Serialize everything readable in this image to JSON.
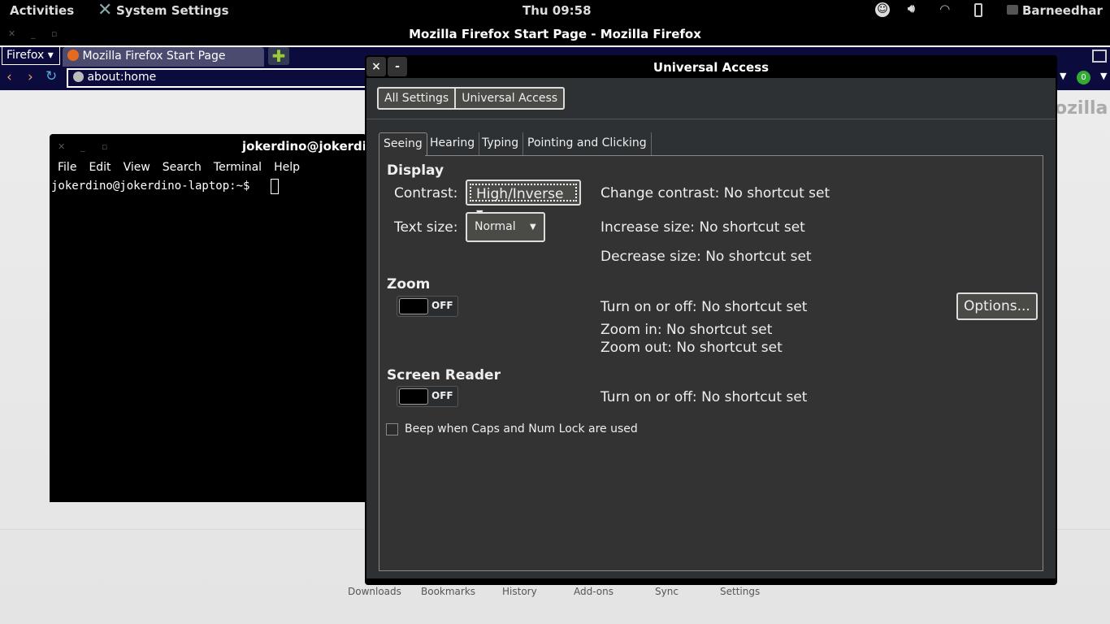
{
  "topbar": {
    "activities": "Activities",
    "app_name": "System Settings",
    "clock": "Thu 09:58",
    "user": "Barneedhar",
    "icons": [
      "accessibility-icon",
      "volume-icon",
      "wifi-icon",
      "battery-icon",
      "chat-icon"
    ]
  },
  "firefox": {
    "window_title": "Mozilla Firefox Start Page - Mozilla Firefox",
    "menu_button": "Firefox",
    "tab_title": "Mozilla Firefox Start Page",
    "url": "about:home",
    "logo_text": "ozilla",
    "badge_count": "0",
    "bottom_items": [
      "Downloads",
      "Bookmarks",
      "History",
      "Add-ons",
      "Sync",
      "Settings"
    ]
  },
  "terminal": {
    "title": "jokerdino@jokerdi",
    "menu": [
      "File",
      "Edit",
      "View",
      "Search",
      "Terminal",
      "Help"
    ],
    "prompt": "jokerdino@jokerdino-laptop:~$"
  },
  "dialog": {
    "title": "Universal Access",
    "close": "×",
    "minimize": "-",
    "breadcrumb": [
      "All Settings",
      "Universal Access"
    ],
    "tabs": [
      "Seeing",
      "Hearing",
      "Typing",
      "Pointing and Clicking"
    ],
    "active_tab": "Seeing",
    "display": {
      "header": "Display",
      "contrast_label": "Contrast:",
      "contrast_value": "High/Inverse",
      "text_size_label": "Text size:",
      "text_size_value": "Normal",
      "shortcuts": [
        {
          "label": "Change contrast:",
          "value": "No shortcut set"
        },
        {
          "label": "Increase size:",
          "value": "No shortcut set"
        },
        {
          "label": "Decrease size:",
          "value": "No shortcut set"
        }
      ]
    },
    "zoom": {
      "header": "Zoom",
      "state": "OFF",
      "options_button": "Options...",
      "shortcuts": [
        {
          "label": "Turn on or off:",
          "value": "No shortcut set"
        },
        {
          "label": "Zoom in:",
          "value": "No shortcut set"
        },
        {
          "label": "Zoom out:",
          "value": "No shortcut set"
        }
      ]
    },
    "screen_reader": {
      "header": "Screen Reader",
      "state": "OFF",
      "shortcuts": [
        {
          "label": "Turn on or off:",
          "value": "No shortcut set"
        }
      ]
    },
    "beep_checkbox": {
      "label": "Beep when Caps and Num Lock are used",
      "checked": false
    }
  }
}
